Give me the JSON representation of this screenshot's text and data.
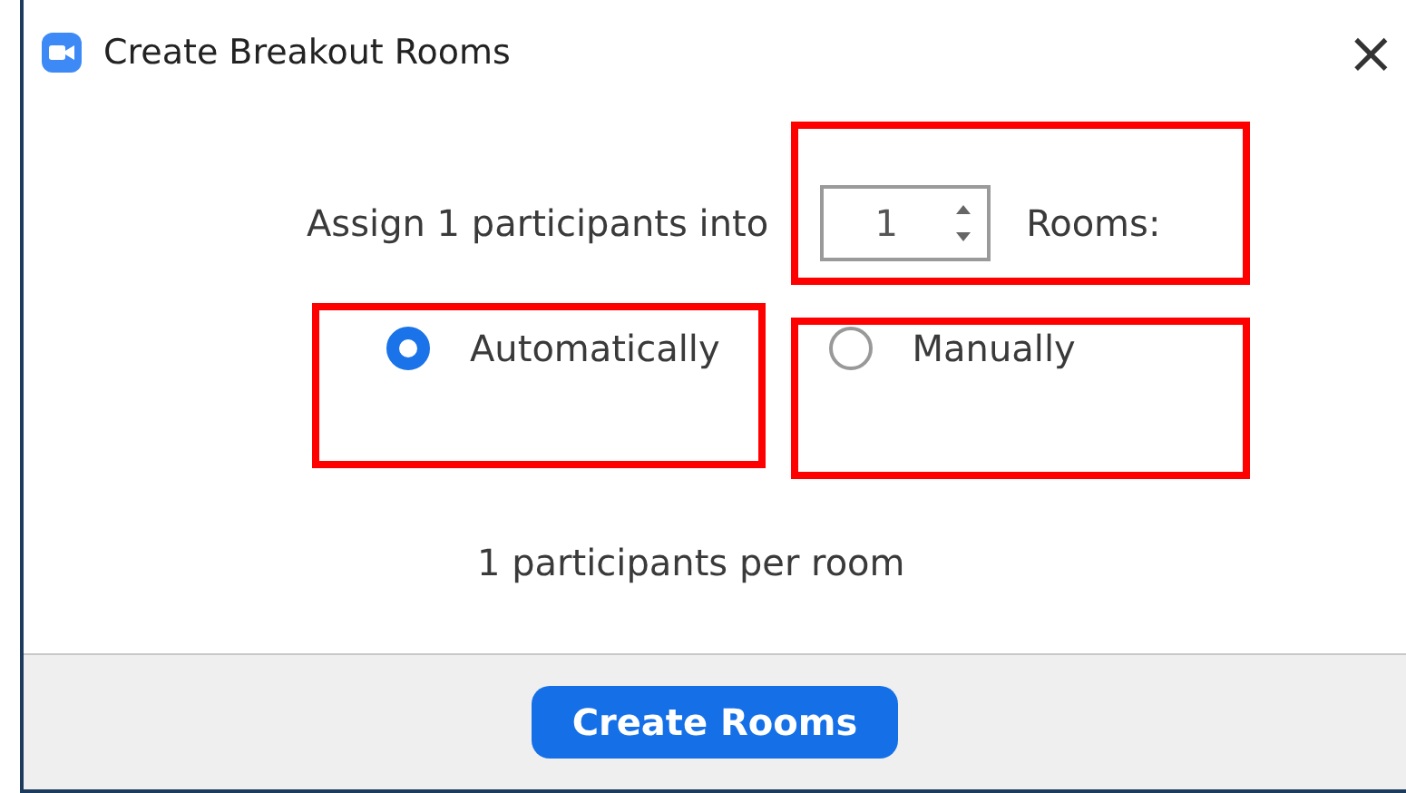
{
  "window": {
    "title": "Create Breakout Rooms",
    "close": "×"
  },
  "assign": {
    "prefix": "Assign 1 participants into",
    "rooms_value": "1",
    "suffix": "Rooms:"
  },
  "options": [
    {
      "label": "Automatically",
      "selected": true
    },
    {
      "label": "Manually",
      "selected": false
    }
  ],
  "summary": "1 participants per room",
  "button": "Create Rooms"
}
